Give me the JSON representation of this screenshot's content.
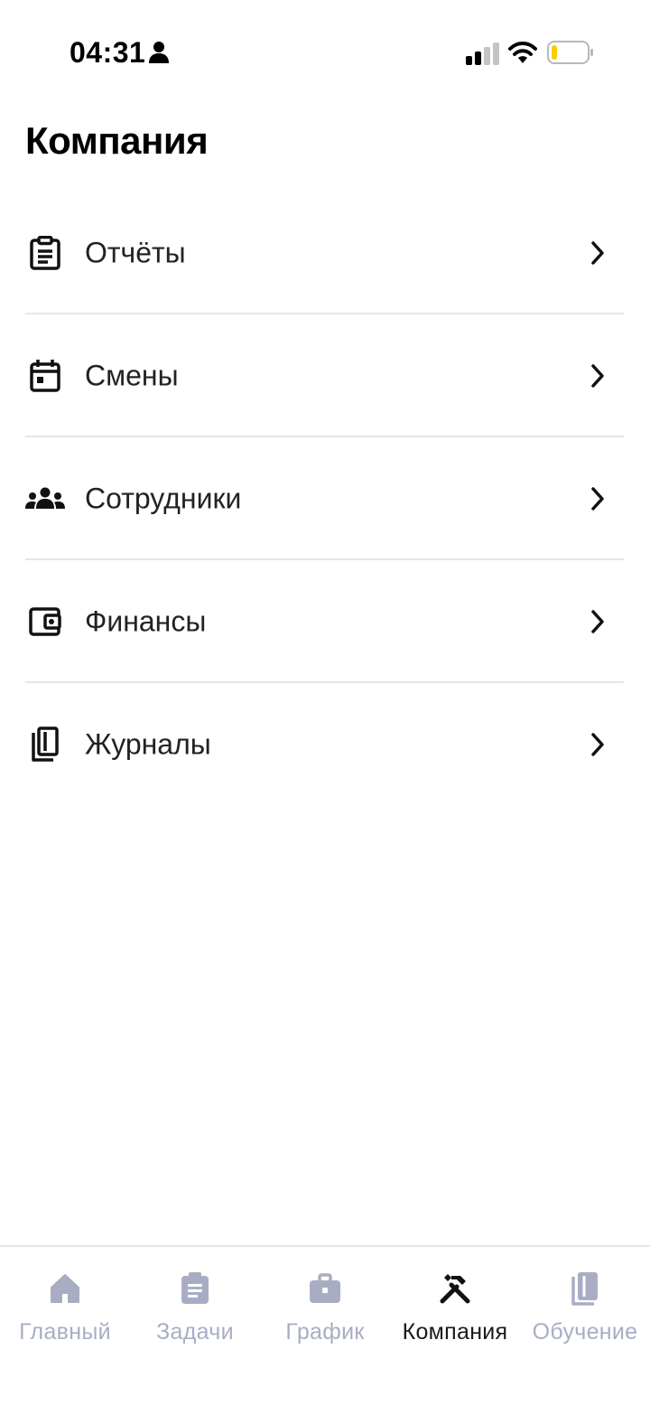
{
  "status_bar": {
    "time": "04:31",
    "icons": [
      "person-icon",
      "signal-icon",
      "wifi-icon",
      "battery-icon"
    ]
  },
  "page": {
    "title": "Компания"
  },
  "menu": {
    "items": [
      {
        "label": "Отчёты",
        "icon": "clipboard-icon"
      },
      {
        "label": "Смены",
        "icon": "calendar-icon"
      },
      {
        "label": "Сотрудники",
        "icon": "people-icon"
      },
      {
        "label": "Финансы",
        "icon": "wallet-icon"
      },
      {
        "label": "Журналы",
        "icon": "journals-icon"
      }
    ]
  },
  "tabbar": {
    "active_index": 3,
    "items": [
      {
        "label": "Главный",
        "icon": "home-icon"
      },
      {
        "label": "Задачи",
        "icon": "clipboard-icon"
      },
      {
        "label": "График",
        "icon": "briefcase-icon"
      },
      {
        "label": "Компания",
        "icon": "tools-icon"
      },
      {
        "label": "Обучение",
        "icon": "book-icon"
      }
    ]
  },
  "colors": {
    "text_primary": "#111111",
    "tab_inactive": "#a9adc4",
    "divider": "#e6e6e8",
    "battery_level": "#f5d000"
  }
}
